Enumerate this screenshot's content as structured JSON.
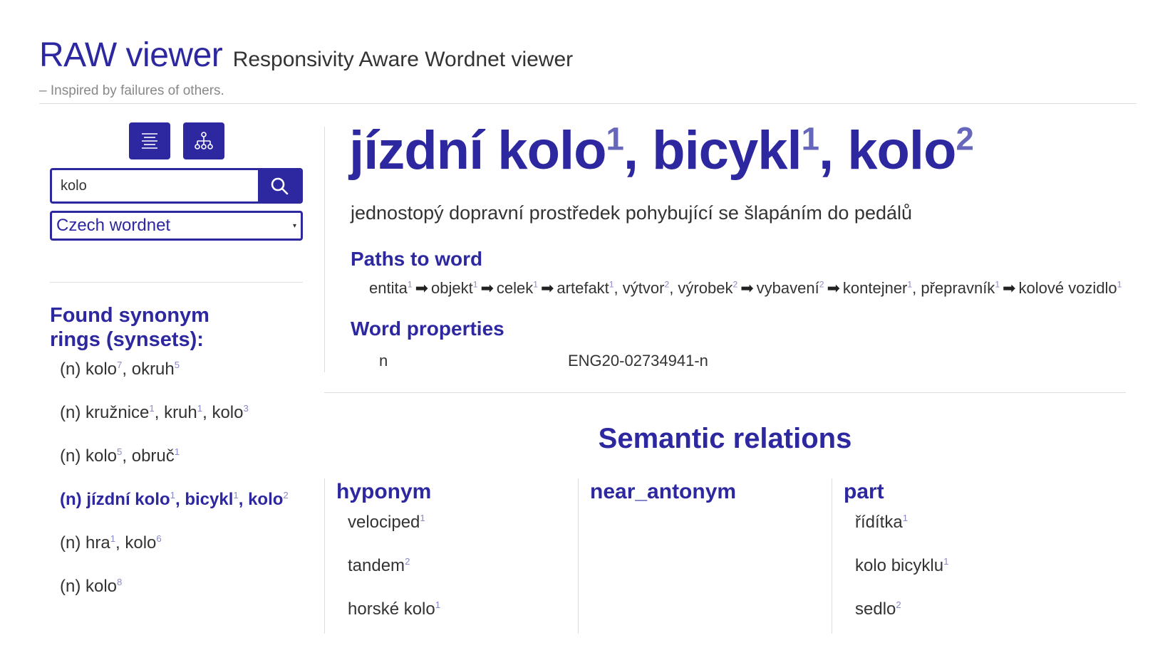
{
  "header": {
    "title": "RAW viewer",
    "subtitle": "Responsivity Aware Wordnet viewer",
    "tagline": "– Inspired by failures of others."
  },
  "sidebar": {
    "search_value": "kolo",
    "wordnet_selected": "Czech wordnet",
    "synsets_heading": "Found synonym rings (synsets):",
    "synsets": [
      {
        "pos": "(n)",
        "words": [
          {
            "w": "kolo",
            "n": "7"
          },
          {
            "w": "okruh",
            "n": "5"
          }
        ],
        "active": false
      },
      {
        "pos": "(n)",
        "words": [
          {
            "w": "kružnice",
            "n": "1"
          },
          {
            "w": "kruh",
            "n": "1"
          },
          {
            "w": "kolo",
            "n": "3"
          }
        ],
        "active": false
      },
      {
        "pos": "(n)",
        "words": [
          {
            "w": "kolo",
            "n": "5"
          },
          {
            "w": "obruč",
            "n": "1"
          }
        ],
        "active": false
      },
      {
        "pos": "(n)",
        "words": [
          {
            "w": "jízdní kolo",
            "n": "1"
          },
          {
            "w": "bicykl",
            "n": "1"
          },
          {
            "w": "kolo",
            "n": "2"
          }
        ],
        "active": true
      },
      {
        "pos": "(n)",
        "words": [
          {
            "w": "hra",
            "n": "1"
          },
          {
            "w": "kolo",
            "n": "6"
          }
        ],
        "active": false
      },
      {
        "pos": "(n)",
        "words": [
          {
            "w": "kolo",
            "n": "8"
          }
        ],
        "active": false
      }
    ]
  },
  "main": {
    "title_words": [
      {
        "w": "jízdní kolo",
        "n": "1"
      },
      {
        "w": "bicykl",
        "n": "1"
      },
      {
        "w": "kolo",
        "n": "2"
      }
    ],
    "definition": "jednostopý dopravní prostředek pohybující se šlapáním do pedálů",
    "paths_title": "Paths to word",
    "path": [
      [
        {
          "w": "entita",
          "n": "1"
        }
      ],
      [
        {
          "w": "objekt",
          "n": "1"
        }
      ],
      [
        {
          "w": "celek",
          "n": "1"
        }
      ],
      [
        {
          "w": "artefakt",
          "n": "1"
        },
        {
          "w": "výtvor",
          "n": "2"
        },
        {
          "w": "výrobek",
          "n": "2"
        }
      ],
      [
        {
          "w": "vybavení",
          "n": "2"
        }
      ],
      [
        {
          "w": "kontejner",
          "n": "1"
        },
        {
          "w": "přepravník",
          "n": "1"
        }
      ],
      [
        {
          "w": "kolové vozidlo",
          "n": "1"
        }
      ]
    ],
    "path_arrow": "➡",
    "props_title": "Word properties",
    "props": {
      "pos": "n",
      "id": "ENG20-02734941-n"
    },
    "semantic_title": "Semantic relations",
    "relations": [
      {
        "name": "hyponym",
        "items": [
          {
            "w": "velociped",
            "n": "1"
          },
          {
            "w": "tandem",
            "n": "2"
          },
          {
            "w": "horské kolo",
            "n": "1"
          }
        ]
      },
      {
        "name": "near_antonym",
        "items": []
      },
      {
        "name": "part",
        "items": [
          {
            "w": "řídítka",
            "n": "1"
          },
          {
            "w": "kolo bicyklu",
            "n": "1"
          },
          {
            "w": "sedlo",
            "n": "2"
          }
        ]
      }
    ]
  },
  "colors": {
    "accent": "#2d28a0",
    "text": "#333333",
    "muted": "#888888",
    "rule": "#dddddd"
  }
}
